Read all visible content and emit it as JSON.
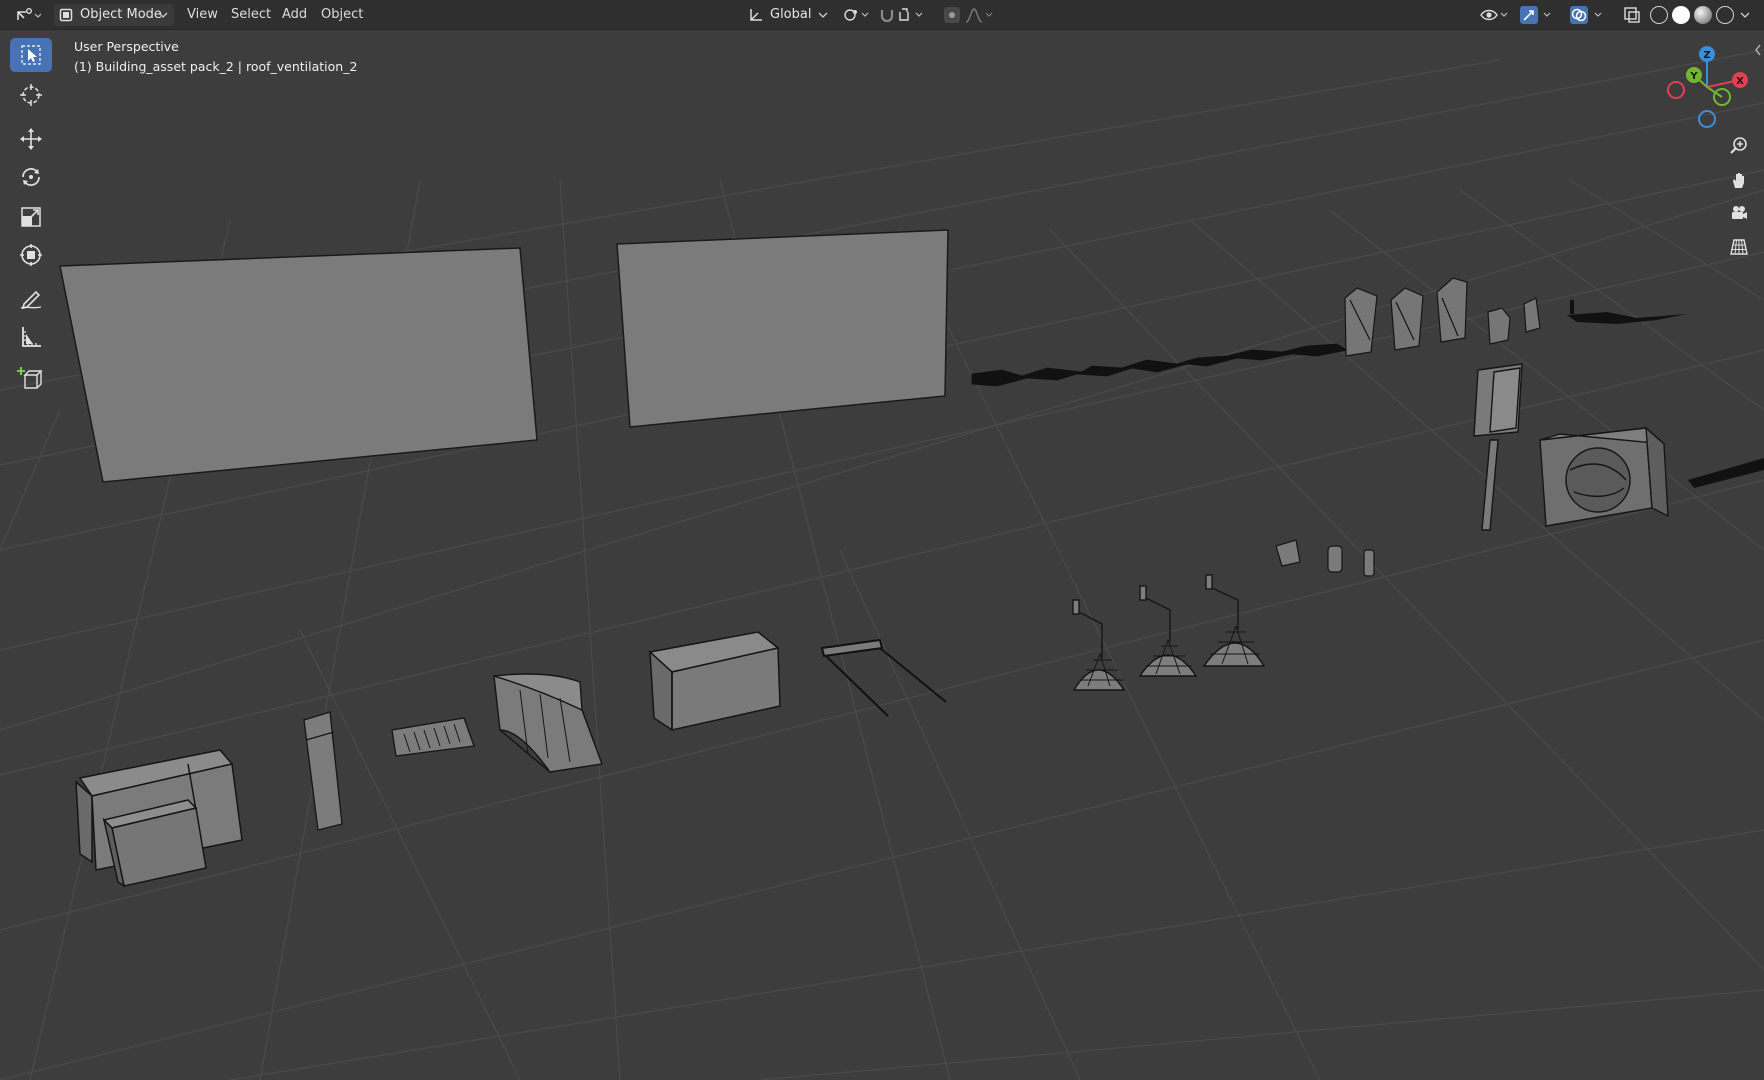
{
  "header": {
    "mode_label": "Object Mode",
    "menus": [
      "View",
      "Select",
      "Add",
      "Object"
    ],
    "orientation_label": "Global"
  },
  "viewport": {
    "view_name": "User Perspective",
    "active_object": "(1) Building_asset pack_2 | roof_ventilation_2"
  },
  "gizmo": {
    "z_label": "Z",
    "y_label": "Y",
    "x_label": "X",
    "colors": {
      "x": "#e0404f",
      "y": "#74b62e",
      "z": "#3d8ed9"
    }
  },
  "toolbar": {
    "tools": [
      "select-box",
      "cursor",
      "move",
      "rotate",
      "scale",
      "transform",
      "annotate",
      "measure",
      "add-cube"
    ],
    "active": "select-box"
  },
  "colors": {
    "header_bg": "#2f2f2f",
    "viewport_bg": "#3d3d3d",
    "grid_line": "#4a4a4a",
    "accent": "#4772b3",
    "mesh_face": "#7b7b7b",
    "mesh_edge": "#111111"
  }
}
